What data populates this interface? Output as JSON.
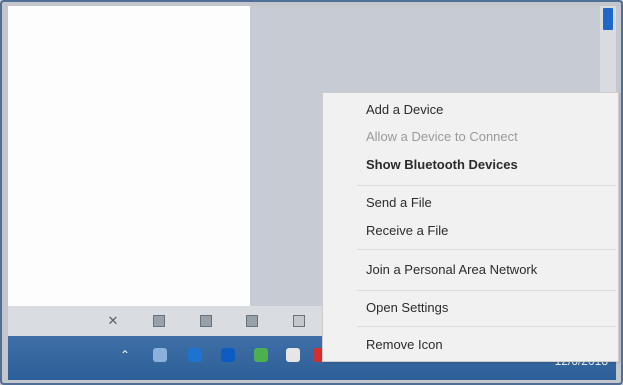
{
  "context_menu": {
    "items": [
      {
        "label": "Add a Device"
      },
      {
        "label": "Allow a Device to Connect"
      },
      {
        "label": "Show Bluetooth Devices"
      },
      {
        "label": "Send a File"
      },
      {
        "label": "Receive a File"
      },
      {
        "label": "Join a Personal Area Network"
      },
      {
        "label": "Open Settings"
      },
      {
        "label": "Remove Icon"
      }
    ]
  },
  "taskbar": {
    "clock_date": "12/6/2018",
    "tray_icons": [
      "expand-tray-icon",
      "network-icon",
      "edge-icon",
      "app-icon",
      "chat-icon",
      "wechat-icon",
      "security-icon",
      "bluetooth-icon",
      "folder-icon"
    ]
  },
  "toolbar": {
    "icons": [
      "fullscreen-icon",
      "window-icon",
      "grid-icon",
      "layout-icon",
      "device-icon"
    ]
  },
  "colors": {
    "taskbar": "#2d5f98",
    "menu_bg": "#f1f1f1",
    "disabled_text": "#9a9a9a"
  }
}
